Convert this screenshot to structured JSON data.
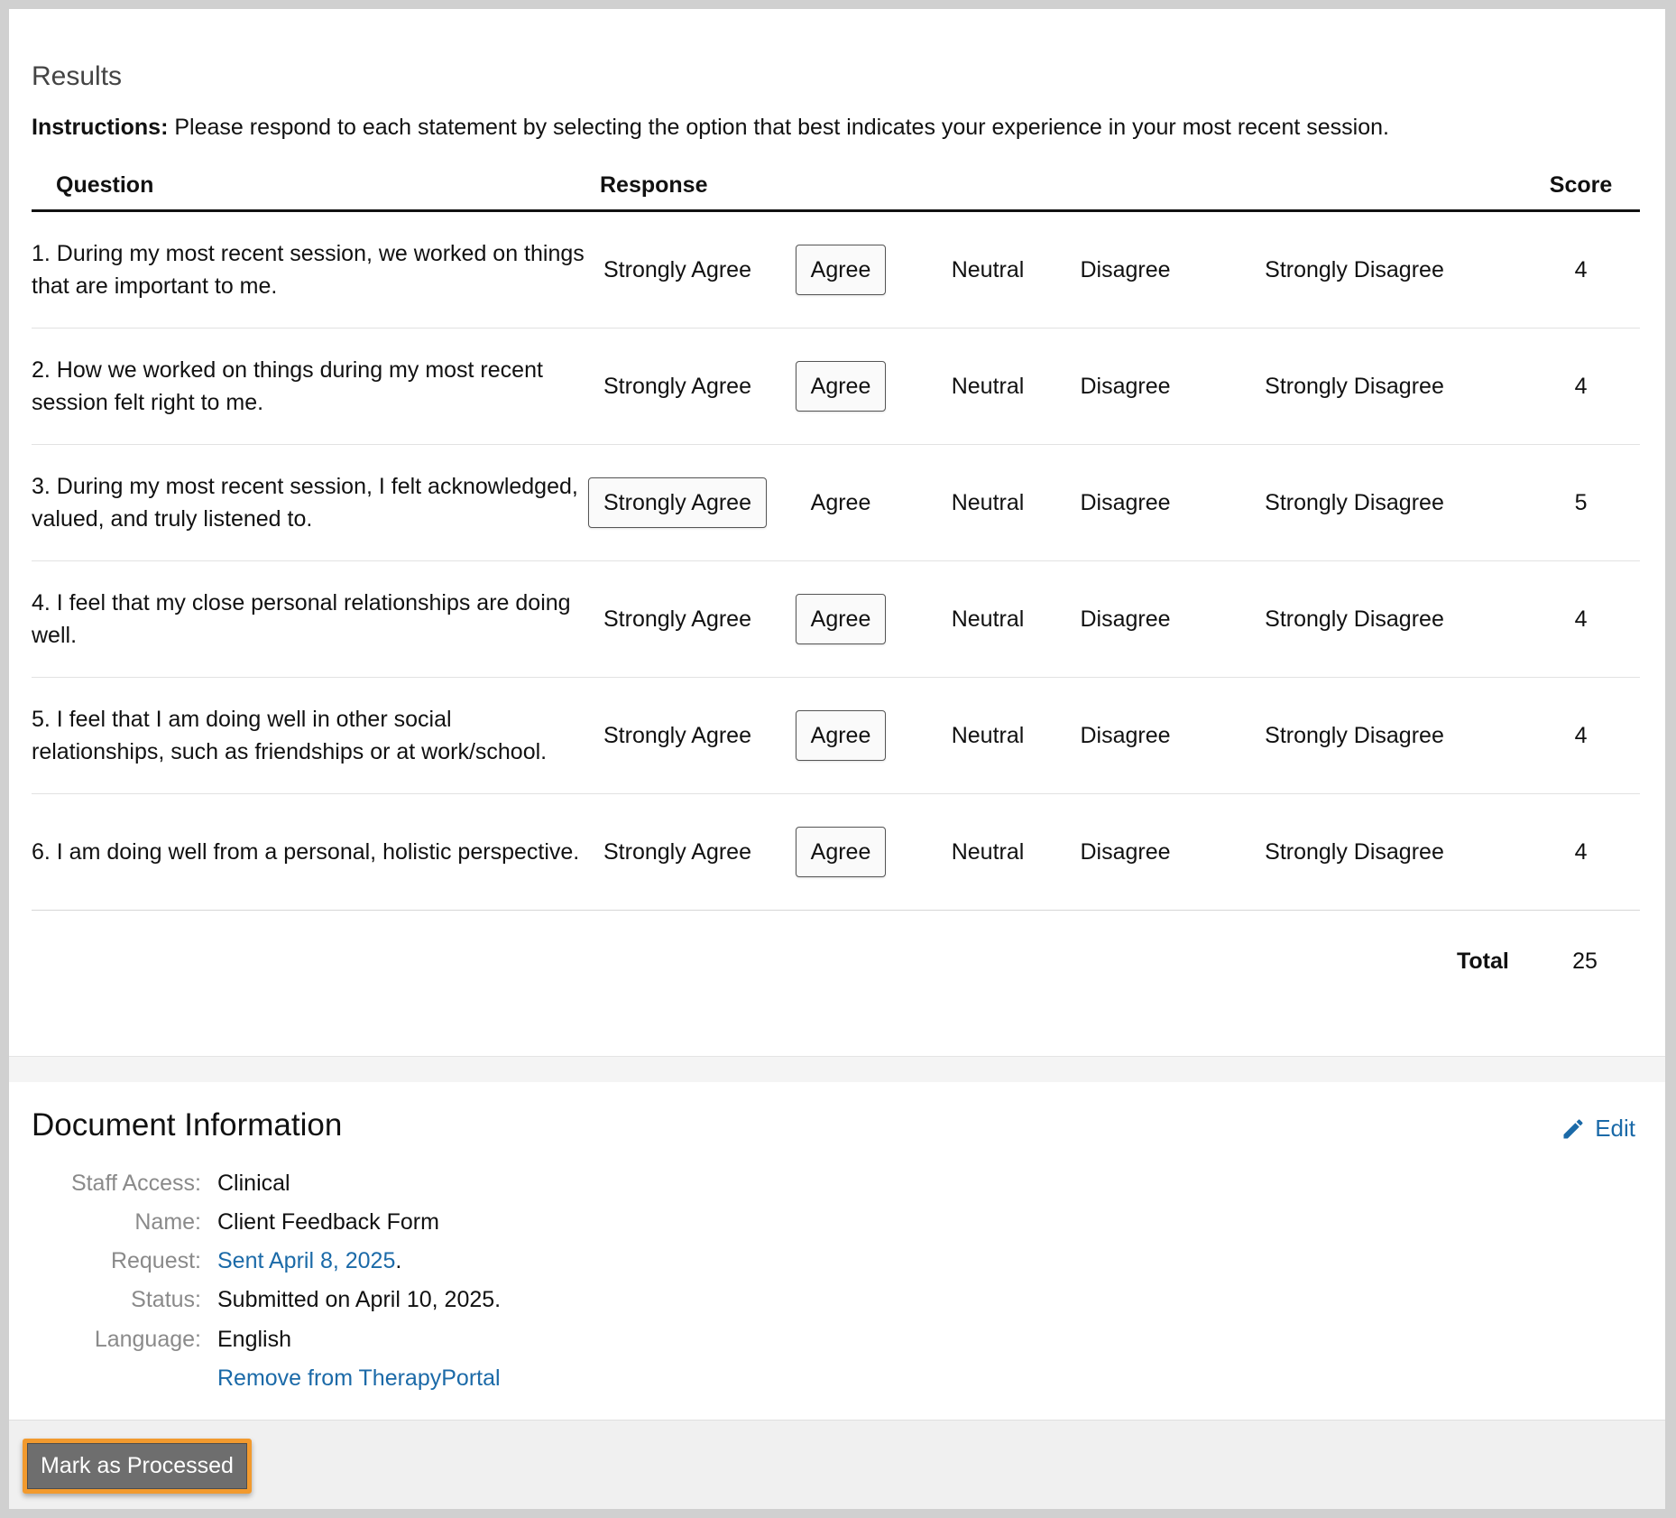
{
  "results": {
    "title": "Results",
    "instructions_bold": "Instructions:",
    "instructions_text": " Please respond to each statement by selecting the option that best indicates your experience in your most recent session.",
    "headers": {
      "question": "Question",
      "response": "Response",
      "score": "Score"
    },
    "options": [
      "Strongly Agree",
      "Agree",
      "Neutral",
      "Disagree",
      "Strongly Disagree"
    ],
    "rows": [
      {
        "question": "1. During my most recent session, we worked on things that are important to me.",
        "selected": "Agree",
        "score": "4"
      },
      {
        "question": "2. How we worked on things during my most recent session felt right to me.",
        "selected": "Agree",
        "score": "4"
      },
      {
        "question": "3. During my most recent session, I felt acknowledged, valued, and truly listened to.",
        "selected": "Strongly Agree",
        "score": "5"
      },
      {
        "question": "4. I feel that my close personal relationships are doing well.",
        "selected": "Agree",
        "score": "4"
      },
      {
        "question": "5. I feel that I am doing well in other social relationships, such as friendships or at work/school.",
        "selected": "Agree",
        "score": "4"
      },
      {
        "question": "6. I am doing well from a personal, holistic perspective.",
        "selected": "Agree",
        "score": "4"
      }
    ],
    "total_label": "Total",
    "total_value": "25"
  },
  "document_info": {
    "title": "Document Information",
    "edit_label": "Edit",
    "edit_icon": "pencil-icon",
    "staff_access_label": "Staff Access:",
    "staff_access_value": "Clinical",
    "name_label": "Name:",
    "name_value": "Client Feedback Form",
    "request_label": "Request:",
    "request_link": "Sent April 8, 2025",
    "request_suffix": ".",
    "status_label": "Status:",
    "status_value": "Submitted on April 10, 2025.",
    "language_label": "Language:",
    "language_value": "English",
    "remove_link": "Remove from TherapyPortal"
  },
  "footer": {
    "mark_processed_label": "Mark as Processed"
  },
  "colors": {
    "link": "#1b6aa8",
    "highlight_border": "#f29a2e",
    "button_bg": "#6e6e6e"
  }
}
